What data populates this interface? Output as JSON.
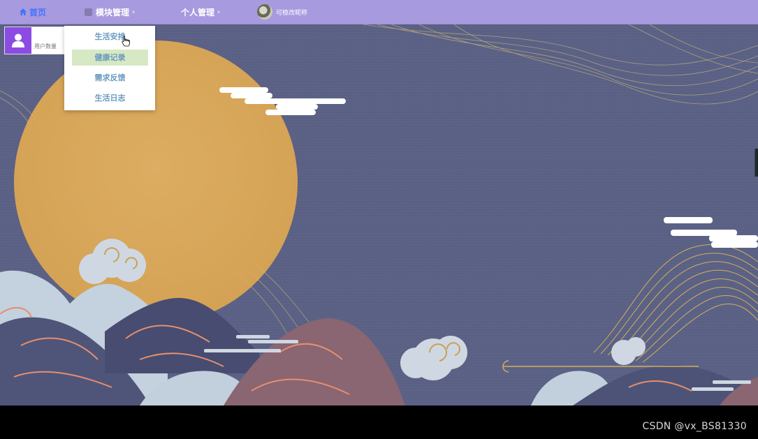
{
  "nav": {
    "home": "首页",
    "module": "模块管理",
    "personal": "个人管理",
    "user_name": "可檢改昵称"
  },
  "card": {
    "label": "用户数量"
  },
  "dropdown": {
    "items": [
      "生活安排",
      "健康记录",
      "需求反馈",
      "生活日志"
    ],
    "highlighted": "健康记录"
  },
  "colors": {
    "nav_bg": "#a89ade",
    "accent": "#3f74ff",
    "card_icon": "#8c4be3",
    "sun": "#d9a95d",
    "sky": "#5c6387"
  },
  "icons": {
    "home": "home-icon",
    "module": "grid-icon",
    "user": "user-icon",
    "cursor": "hand-cursor-icon"
  },
  "watermark": "CSDN @vx_BS81330"
}
